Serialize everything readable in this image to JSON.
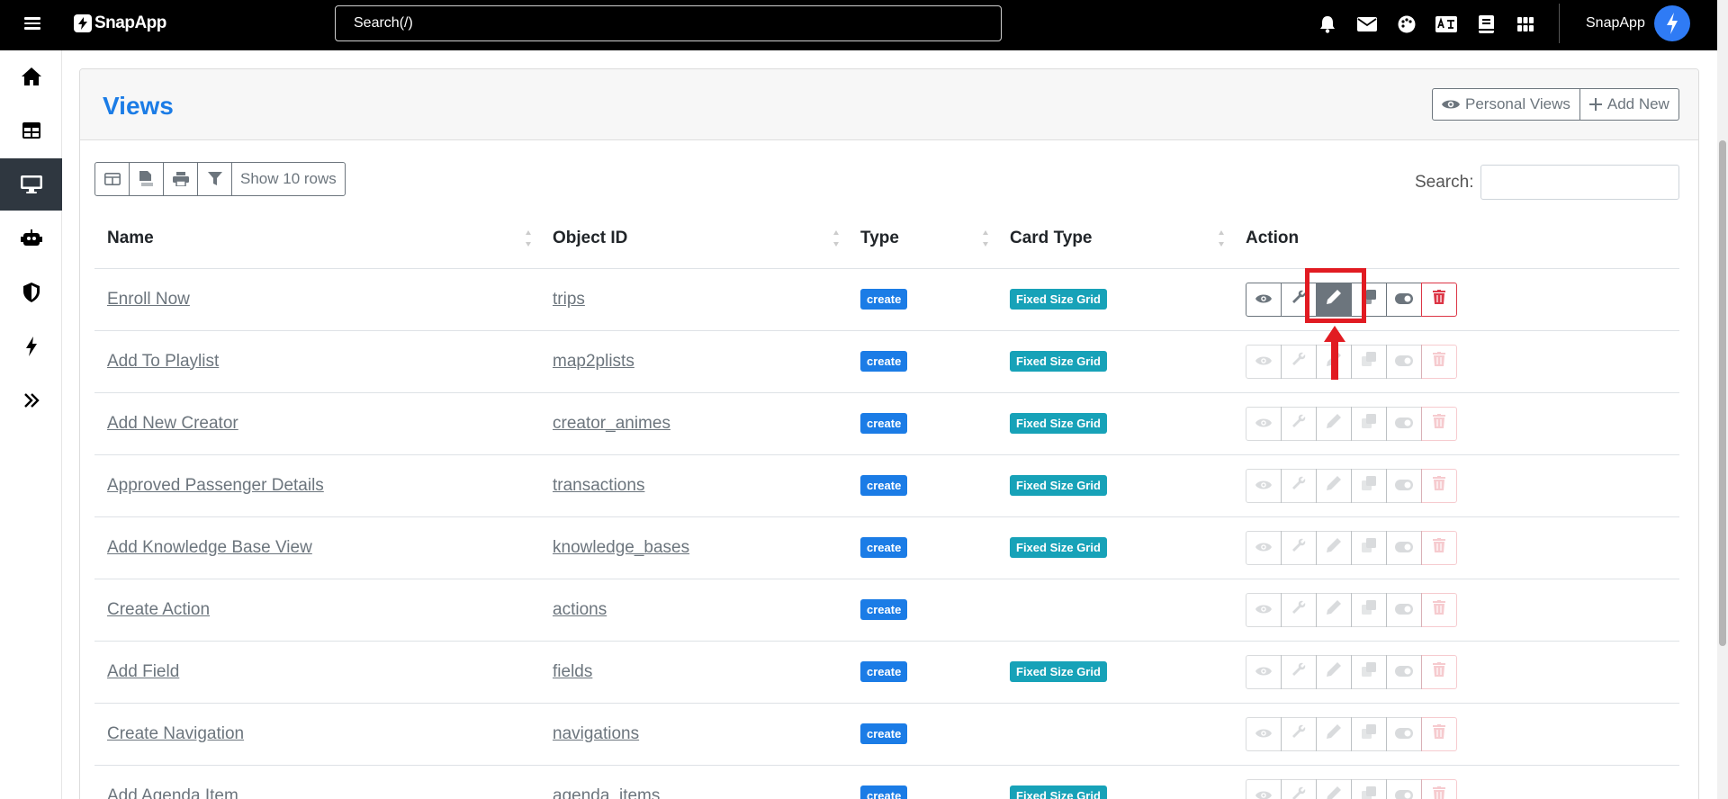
{
  "topbar": {
    "brand": "SnapApp",
    "search_placeholder": "Search(/)",
    "icons": [
      "bell-icon",
      "envelope-icon",
      "palette-icon",
      "language-icon",
      "book-icon",
      "apps-grid-icon"
    ],
    "user_name": "SnapApp"
  },
  "sidebar": {
    "items": [
      "home",
      "tables",
      "views",
      "bots",
      "security",
      "actions",
      "expand"
    ],
    "active": "views"
  },
  "page": {
    "title": "Views",
    "personal_views_label": "Personal Views",
    "add_new_label": "Add New",
    "show_rows_label": "Show 10 rows",
    "search_label": "Search:"
  },
  "table": {
    "columns": [
      "Name",
      "Object ID",
      "Type",
      "Card Type",
      "Action"
    ],
    "rows": [
      {
        "name": "Enroll Now",
        "object_id": "trips",
        "type": "create",
        "card_type": "Fixed Size Grid"
      },
      {
        "name": "Add To Playlist",
        "object_id": "map2plists",
        "type": "create",
        "card_type": "Fixed Size Grid"
      },
      {
        "name": "Add New Creator",
        "object_id": "creator_animes",
        "type": "create",
        "card_type": "Fixed Size Grid"
      },
      {
        "name": "Approved Passenger Details",
        "object_id": "transactions",
        "type": "create",
        "card_type": "Fixed Size Grid"
      },
      {
        "name": "Add Knowledge Base View",
        "object_id": "knowledge_bases",
        "type": "create",
        "card_type": "Fixed Size Grid"
      },
      {
        "name": "Create Action",
        "object_id": "actions",
        "type": "create",
        "card_type": ""
      },
      {
        "name": "Add Field",
        "object_id": "fields",
        "type": "create",
        "card_type": "Fixed Size Grid"
      },
      {
        "name": "Create Navigation",
        "object_id": "navigations",
        "type": "create",
        "card_type": ""
      },
      {
        "name": "Add Agenda Item",
        "object_id": "agenda_items",
        "type": "create",
        "card_type": "Fixed Size Grid"
      }
    ]
  },
  "colors": {
    "accent": "#1b7ce6",
    "card_badge": "#17a2b8",
    "danger": "#dc3545",
    "highlight": "#e11b22"
  }
}
